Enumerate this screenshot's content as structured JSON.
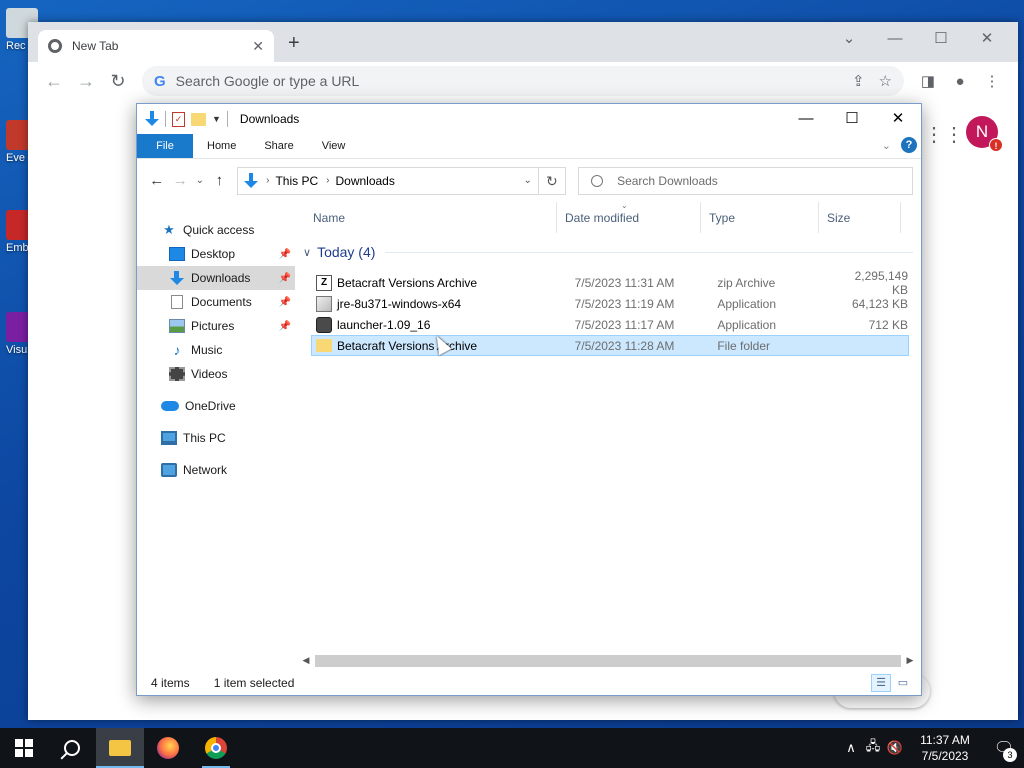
{
  "desktop": {
    "icons": [
      {
        "label": "Rec",
        "color": "#cfd8dc"
      },
      {
        "label": "Eve",
        "color": "#c0392b"
      },
      {
        "label": "Emb De",
        "color": "#c62828"
      },
      {
        "label": "Visu",
        "color": "#7b1fa2"
      }
    ]
  },
  "chrome": {
    "tab_title": "New Tab",
    "tab_close": "✕",
    "new_tab": "+",
    "omnibox_placeholder": "Search Google or type a URL",
    "omnibox_g": "G",
    "avatar_letter": "N",
    "avatar_badge": "!",
    "customize_label": "ze Chrome",
    "window_controls": {
      "tabsearch": "⌄",
      "minimize": "—",
      "maximize": "☐",
      "close": "✕"
    },
    "toolbar_icons": {
      "back": "←",
      "forward": "→",
      "reload": "↻",
      "share": "⇪",
      "bookmark": "☆",
      "sidepanel": "◨",
      "profile": "●",
      "menu": "⋮",
      "apps": "⋮⋮⋮"
    }
  },
  "explorer": {
    "title": "Downloads",
    "caption": {
      "minimize": "—",
      "maximize": "☐",
      "close": "✕"
    },
    "ribbon_tabs": [
      "File",
      "Home",
      "Share",
      "View"
    ],
    "ribbon_chevron": "⌄",
    "help": "?",
    "address": {
      "crumbs": [
        "This PC",
        "Downloads"
      ],
      "separator": "›"
    },
    "nav_buttons": {
      "back": "←",
      "forward": "→",
      "recent": "⌄",
      "up": "↑",
      "refresh": "↻"
    },
    "search_placeholder": "Search Downloads",
    "nav_pane": {
      "quick_access": "Quick access",
      "pinned": [
        {
          "label": "Desktop",
          "pinned": true
        },
        {
          "label": "Downloads",
          "pinned": true,
          "selected": true
        },
        {
          "label": "Documents",
          "pinned": true
        },
        {
          "label": "Pictures",
          "pinned": true
        },
        {
          "label": "Music",
          "pinned": false
        },
        {
          "label": "Videos",
          "pinned": false
        }
      ],
      "onedrive": "OneDrive",
      "this_pc": "This PC",
      "network": "Network"
    },
    "columns": {
      "name": "Name",
      "date": "Date modified",
      "type": "Type",
      "size": "Size"
    },
    "group_label": "Today (4)",
    "files": [
      {
        "name": "Betacraft Versions Archive",
        "date": "7/5/2023 11:31 AM",
        "type": "zip Archive",
        "size": "2,295,149 KB",
        "icon": "zip-icon"
      },
      {
        "name": "jre-8u371-windows-x64",
        "date": "7/5/2023 11:19 AM",
        "type": "Application",
        "size": "64,123 KB",
        "icon": "installer-icon"
      },
      {
        "name": "launcher-1.09_16",
        "date": "7/5/2023 11:17 AM",
        "type": "Application",
        "size": "712 KB",
        "icon": "launcher-icon"
      },
      {
        "name": "Betacraft Versions Archive",
        "date": "7/5/2023 11:28 AM",
        "type": "File folder",
        "size": "",
        "icon": "folder-icon",
        "selected": true
      }
    ],
    "status": {
      "items": "4 items",
      "selected": "1 item selected"
    }
  },
  "taskbar": {
    "clock_time": "11:37 AM",
    "clock_date": "7/5/2023",
    "notification_count": "3"
  },
  "colors": {
    "desktop": "#0d47a1",
    "accent": "#1979ca",
    "selection": "#cce8ff",
    "chrome_avatar": "#c2185b"
  }
}
